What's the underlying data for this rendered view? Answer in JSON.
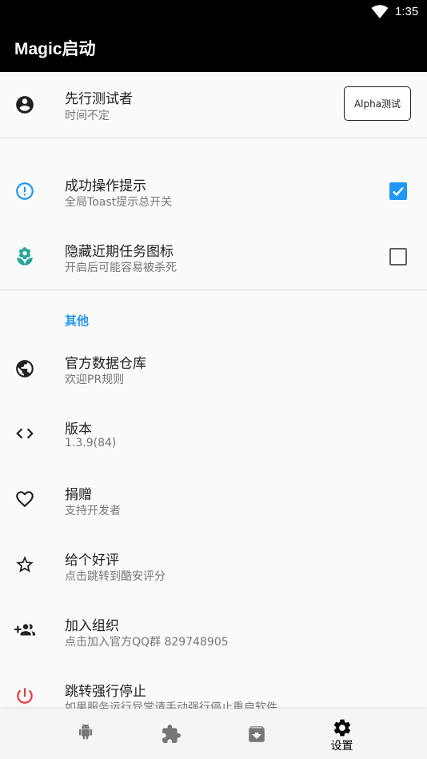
{
  "status_bar": {
    "time": "1:35"
  },
  "app_bar": {
    "title": "Magic启动"
  },
  "tester": {
    "title": "先行测试者",
    "subtitle": "时间不定",
    "button_label": "Alpha测试"
  },
  "toast": {
    "title": "成功操作提示",
    "subtitle": "全局Toast提示总开关",
    "checked": true
  },
  "hide_recent": {
    "title": "隐藏近期任务图标",
    "subtitle": "开启后可能容易被杀死",
    "checked": false
  },
  "other_section": {
    "header": "其他"
  },
  "items": [
    {
      "title": "官方数据仓库",
      "subtitle": "欢迎PR规则",
      "icon": "globe-icon"
    },
    {
      "title": "版本",
      "subtitle": "1.3.9(84)",
      "icon": "code-icon"
    },
    {
      "title": "捐赠",
      "subtitle": "支持开发者",
      "icon": "heart-icon"
    },
    {
      "title": "给个好评",
      "subtitle": "点击跳转到酷安评分",
      "icon": "star-icon"
    },
    {
      "title": "加入组织",
      "subtitle": "点击加入官方QQ群 829748905",
      "icon": "group-add-icon"
    },
    {
      "title": "跳转强行停止",
      "subtitle": "如果服务运行异常请手动强行停止重启软件",
      "icon": "power-icon"
    }
  ],
  "bottom_nav": {
    "active_label": "设置",
    "items": [
      "android-icon",
      "puzzle-icon",
      "archive-icon",
      "settings-icon"
    ]
  },
  "colors": {
    "accent": "#2196f3",
    "teal": "#26a69a",
    "red": "#e53935"
  }
}
